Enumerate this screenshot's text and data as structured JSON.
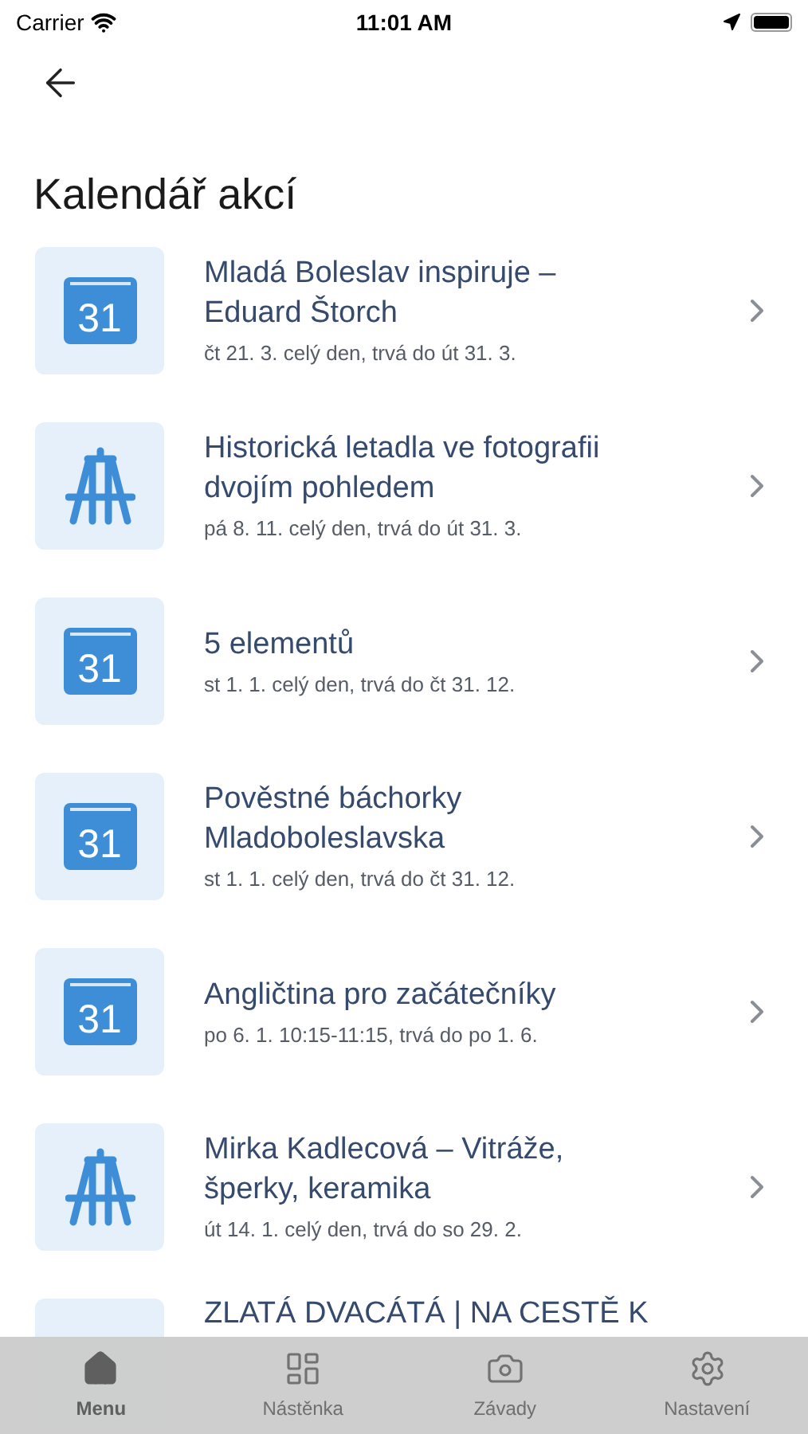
{
  "status_bar": {
    "carrier": "Carrier",
    "time": "11:01 AM"
  },
  "title": "Kalendář akcí",
  "events": [
    {
      "kind": "calendar",
      "icon_text": "31",
      "title": "Mladá Boleslav inspiruje – Eduard Štorch",
      "when": "čt 21. 3. celý den, trvá do út 31. 3."
    },
    {
      "kind": "easel",
      "title": "Historická letadla ve fotografii dvojím pohledem",
      "when": "pá 8. 11. celý den, trvá do út 31. 3."
    },
    {
      "kind": "calendar",
      "icon_text": "31",
      "title": "5 elementů",
      "when": "st 1. 1. celý den, trvá do čt 31. 12."
    },
    {
      "kind": "calendar",
      "icon_text": "31",
      "title": "Pověstné báchorky Mladoboleslavska",
      "when": "st 1. 1. celý den, trvá do čt 31. 12."
    },
    {
      "kind": "calendar",
      "icon_text": "31",
      "title": "Angličtina pro začátečníky",
      "when": "po 6. 1. 10:15-11:15, trvá do po 1. 6."
    },
    {
      "kind": "easel",
      "title": "Mirka Kadlecová – Vitráže, šperky, keramika",
      "when": "út 14. 1. celý den, trvá do so 29. 2."
    },
    {
      "kind": "partial",
      "title": "ZLATÁ DVACÁTÁ | NA CESTĚ K"
    }
  ],
  "tabs": [
    {
      "kind": "home",
      "label": "Menu",
      "selected": true
    },
    {
      "kind": "board",
      "label": "Nástěnka",
      "selected": false
    },
    {
      "kind": "camera",
      "label": "Závady",
      "selected": false
    },
    {
      "kind": "gear",
      "label": "Nastavení",
      "selected": false
    }
  ]
}
